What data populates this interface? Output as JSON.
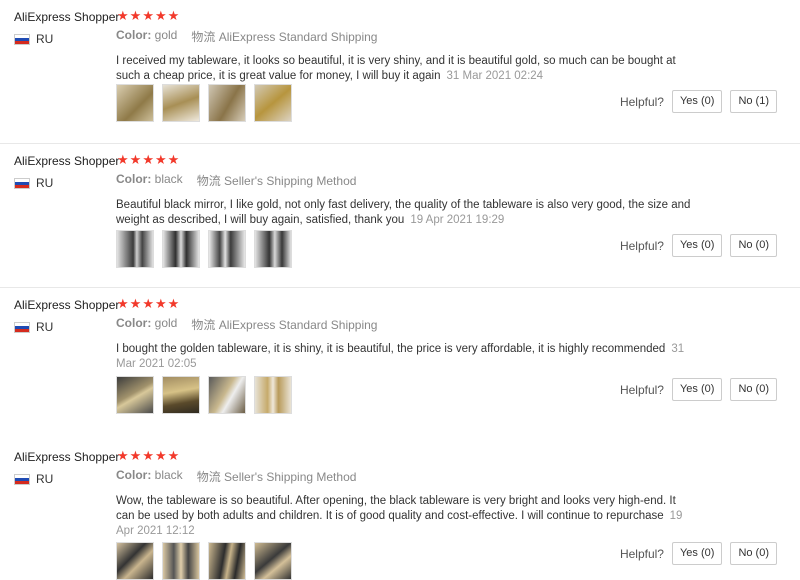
{
  "reviews": [
    {
      "name": "AliExpress Shopper",
      "country": "RU",
      "stars": 5,
      "color_label": "Color:",
      "color": "gold",
      "shipping_label": "物流",
      "shipping": "AliExpress Standard Shipping",
      "text": "I received my tableware, it looks so beautiful, it is very shiny, and it is beautiful gold, so much can be bought at such a cheap price, it is great value for money, I will buy it again",
      "date": "31 Mar 2021 02:24",
      "helpful_label": "Helpful?",
      "yes": "Yes (0)",
      "no": "No (1)"
    },
    {
      "name": "AliExpress Shopper",
      "country": "RU",
      "stars": 5,
      "color_label": "Color:",
      "color": "black",
      "shipping_label": "物流",
      "shipping": "Seller's Shipping Method",
      "text": "Beautiful black mirror, I like gold, not only fast delivery, the quality of the tableware is also very good, the size and weight as described, I will buy again, satisfied, thank you",
      "date": "19 Apr 2021 19:29",
      "helpful_label": "Helpful?",
      "yes": "Yes (0)",
      "no": "No (0)"
    },
    {
      "name": "AliExpress Shopper",
      "country": "RU",
      "stars": 5,
      "color_label": "Color:",
      "color": "gold",
      "shipping_label": "物流",
      "shipping": "AliExpress Standard Shipping",
      "text": "I bought the golden tableware, it is shiny, it is beautiful, the price is very affordable, it is highly recommended",
      "date": "31 Mar 2021 02:05",
      "helpful_label": "Helpful?",
      "yes": "Yes (0)",
      "no": "No (0)"
    },
    {
      "name": "AliExpress Shopper",
      "country": "RU",
      "stars": 5,
      "color_label": "Color:",
      "color": "black",
      "shipping_label": "物流",
      "shipping": "Seller's Shipping Method",
      "text": "Wow, the tableware is so beautiful. After opening, the black tableware is very bright and looks very high-end. It can be used by both adults and children. It is of good quality and cost-effective. I will continue to repurchase",
      "date": "19 Apr 2021 12:12",
      "helpful_label": "Helpful?",
      "yes": "Yes (0)",
      "no": "No (0)"
    }
  ],
  "colors": {
    "star": "#f2392b",
    "flag_white": "#ffffff",
    "flag_blue": "#1f4bb4",
    "flag_red": "#d52b1e",
    "gold_photo": "#b89a5a",
    "black_photo": "#3a3a3a"
  }
}
